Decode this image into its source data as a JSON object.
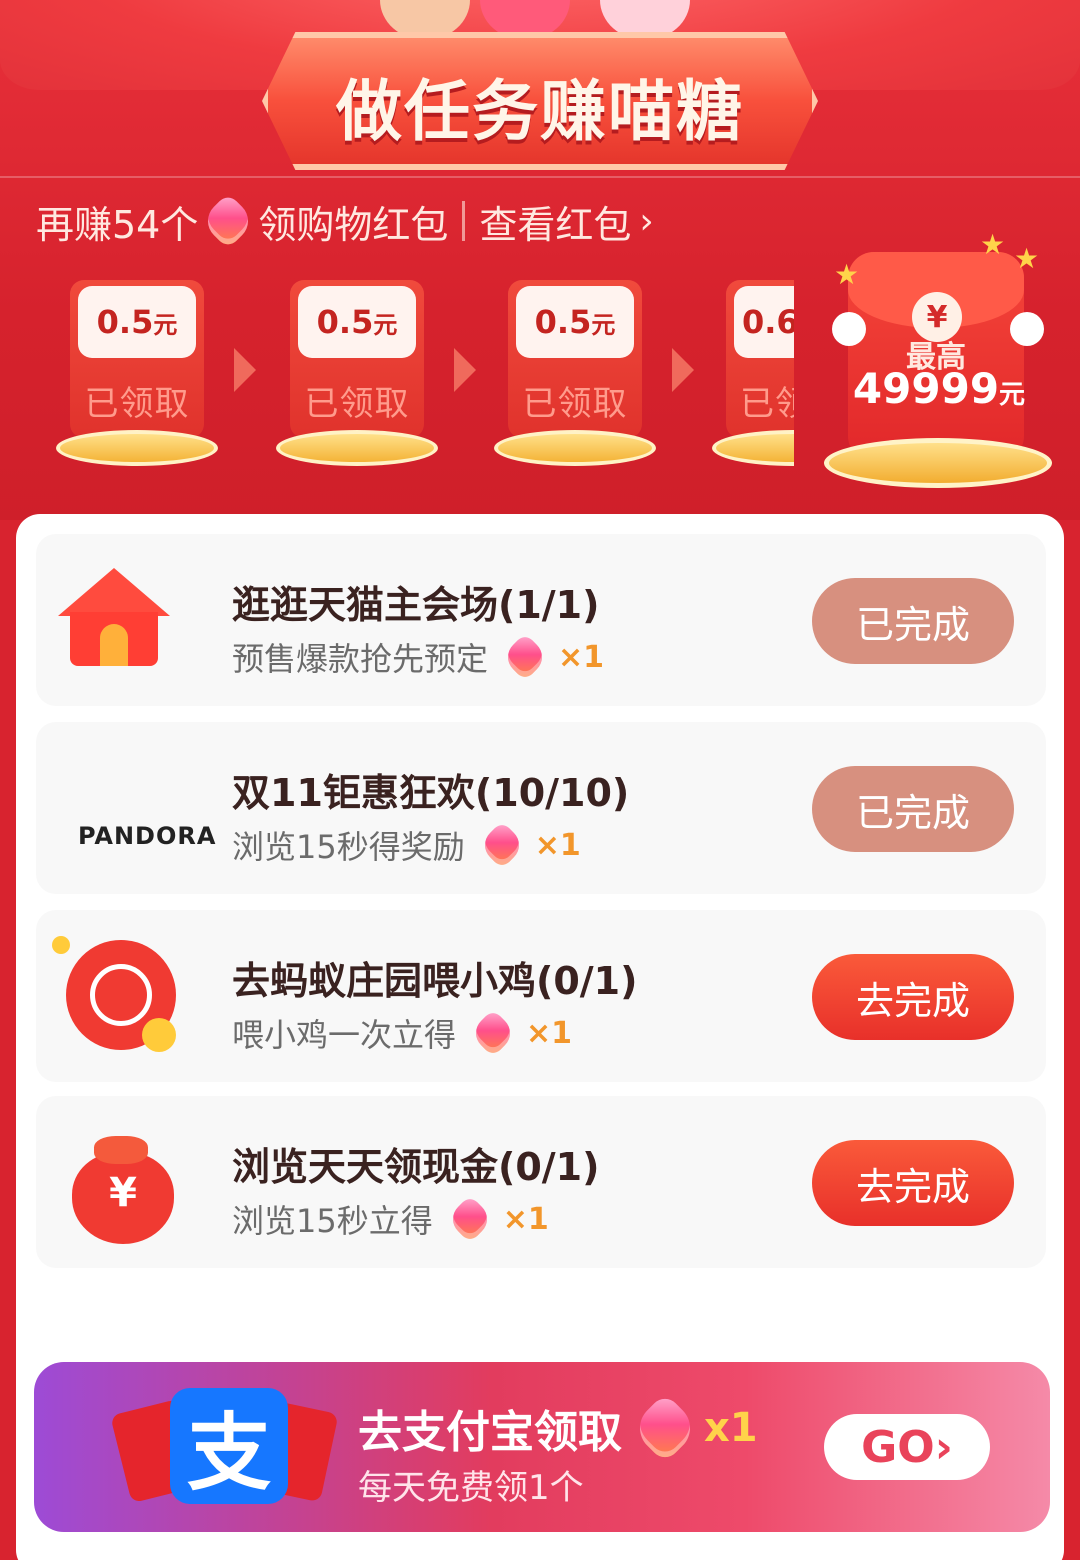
{
  "header": {
    "title": "做任务赚喵糖"
  },
  "progress": {
    "prefix": "再赚54个",
    "suffix": "领购物红包",
    "link": "查看红包",
    "link_arrow": "›"
  },
  "red_packets": [
    {
      "amount": "0.5",
      "unit": "元",
      "status": "已领取"
    },
    {
      "amount": "0.5",
      "unit": "元",
      "status": "已领取"
    },
    {
      "amount": "0.5",
      "unit": "元",
      "status": "已领取"
    },
    {
      "amount": "0.6",
      "unit": "",
      "status": "已领取"
    }
  ],
  "grand_prize": {
    "yen": "¥",
    "label": "最高",
    "amount": "49999",
    "unit": "元"
  },
  "tasks": [
    {
      "title": "逛逛天猫主会场(1/1)",
      "desc": "预售爆款抢先预定",
      "reward": "×1",
      "button": "已完成",
      "done": true
    },
    {
      "title": "双11钜惠狂欢(10/10)",
      "desc": "浏览15秒得奖励",
      "reward": "×1",
      "button": "已完成",
      "done": true,
      "brand": "PANDORA"
    },
    {
      "title": "去蚂蚁庄园喂小鸡(0/1)",
      "desc": "喂小鸡一次立得",
      "reward": "×1",
      "button": "去完成",
      "done": false
    },
    {
      "title": "浏览天天领现金(0/1)",
      "desc": "浏览15秒立得",
      "reward": "×1",
      "button": "去完成",
      "done": false
    }
  ],
  "bag_symbol": "¥",
  "banner": {
    "logo_char": "支",
    "title": "去支付宝领取",
    "reward": "x1",
    "subtitle": "每天免费领1个",
    "button": "GO›"
  },
  "colors": {
    "background_red": "#d8232f",
    "done_button": "#d7907f",
    "go_button": "#e8302a",
    "reward_orange": "#f2962b",
    "alipay_blue": "#1677ff"
  }
}
